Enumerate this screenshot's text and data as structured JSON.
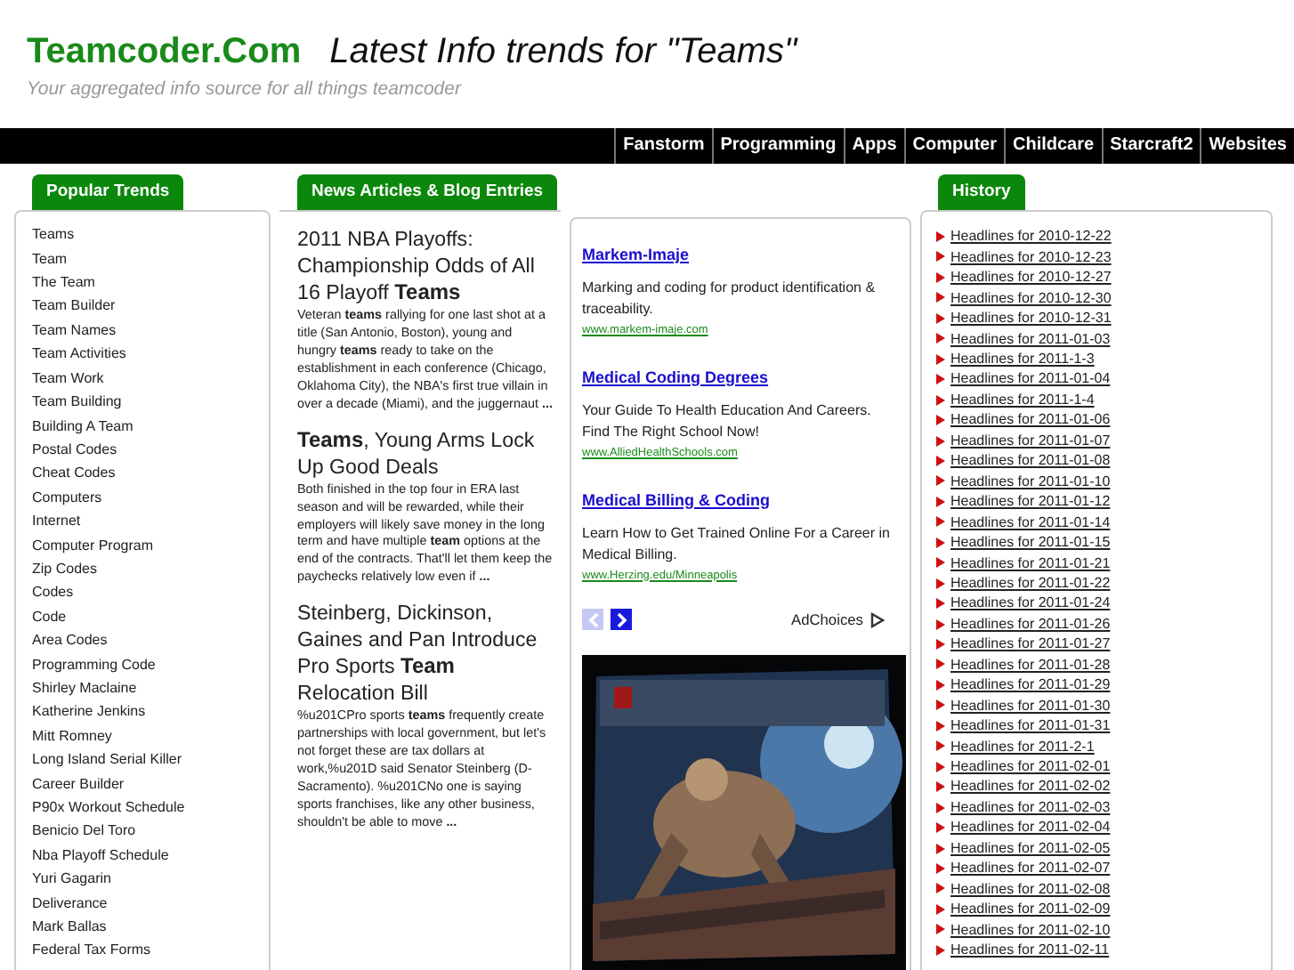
{
  "header": {
    "logo": "Teamcoder.Com",
    "headline": "Latest Info trends for \"Teams\"",
    "tagline": "Your aggregated info source for all things teamcoder"
  },
  "nav": [
    "Fanstorm",
    "Programming",
    "Apps",
    "Computer",
    "Childcare",
    "Starcraft2",
    "Websites"
  ],
  "trends": {
    "title": "Popular Trends",
    "items": [
      "Teams",
      "Team",
      "The Team",
      "Team Builder",
      "Team Names",
      "Team Activities",
      "Team Work",
      "Team Building",
      "Building A Team",
      "Postal Codes",
      "Cheat Codes",
      "Computers",
      "Internet",
      "Computer Program",
      "Zip Codes",
      "Codes",
      "Code",
      "Area Codes",
      "Programming Code",
      "Shirley Maclaine",
      "Katherine Jenkins",
      "Mitt Romney",
      "Long Island Serial Killer",
      "Career Builder",
      "P90x Workout Schedule",
      "Benicio Del Toro",
      "Nba Playoff Schedule",
      "Yuri Gagarin",
      "Deliverance",
      "Mark Ballas",
      "Federal Tax Forms"
    ]
  },
  "news": {
    "title": "News Articles & Blog Entries",
    "articles": [
      {
        "title": "2011 NBA Playoffs: Championship Odds of All 16 Playoff **Teams**",
        "summary": "Veteran **teams** rallying for one last shot at a title (San Antonio, Boston), young and hungry **teams** ready to take on the establishment in each conference (Chicago, Oklahoma City), the NBA's first true villain in over a decade (Miami), and the juggernaut **...**"
      },
      {
        "title": "**Teams**, Young Arms Lock Up Good Deals",
        "summary": "Both finished in the top four in ERA last season and will be rewarded, while their employers will likely save money in the long term and have multiple **team** options at the end of the contracts. That'll let them keep the paychecks relatively low even if **...**"
      },
      {
        "title": "Steinberg, Dickinson, Gaines and Pan Introduce Pro Sports **Team** Relocation Bill",
        "summary": "%u201CPro sports **teams** frequently create partnerships with local government, but let's not forget these are tax dollars at work,%u201D said Senator Steinberg (D-Sacramento). %u201CNo one is saying sports franchises, like any other business, shouldn't be able to move **...**"
      }
    ]
  },
  "ads": {
    "items": [
      {
        "title": "Markem-Imaje",
        "text": "Marking and coding for product identification & traceability.",
        "url": "www.markem-imaje.com"
      },
      {
        "title": "Medical Coding Degrees",
        "text": "Your Guide To Health Education And Careers. Find The Right School Now!",
        "url": "www.AlliedHealthSchools.com"
      },
      {
        "title": "Medical Billing & Coding",
        "text": "Learn How to Get Trained Online For a Career in Medical Billing.",
        "url": "www.Herzing.edu/Minneapolis"
      }
    ],
    "prev": {
      "disabled": true
    },
    "next": {
      "disabled": false
    },
    "adchoices": "AdChoices"
  },
  "history": {
    "title": "History",
    "items": [
      "Headlines for 2010-12-22",
      "Headlines for 2010-12-23",
      "Headlines for 2010-12-27",
      "Headlines for 2010-12-30",
      "Headlines for 2010-12-31",
      "Headlines for 2011-01-03",
      "Headlines for 2011-1-3",
      "Headlines for 2011-01-04",
      "Headlines for 2011-1-4",
      "Headlines for 2011-01-06",
      "Headlines for 2011-01-07",
      "Headlines for 2011-01-08",
      "Headlines for 2011-01-10",
      "Headlines for 2011-01-12",
      "Headlines for 2011-01-14",
      "Headlines for 2011-01-15",
      "Headlines for 2011-01-21",
      "Headlines for 2011-01-22",
      "Headlines for 2011-01-24",
      "Headlines for 2011-01-26",
      "Headlines for 2011-01-27",
      "Headlines for 2011-01-28",
      "Headlines for 2011-01-29",
      "Headlines for 2011-01-30",
      "Headlines for 2011-01-31",
      "Headlines for 2011-2-1",
      "Headlines for 2011-02-01",
      "Headlines for 2011-02-02",
      "Headlines for 2011-02-03",
      "Headlines for 2011-02-04",
      "Headlines for 2011-02-05",
      "Headlines for 2011-02-07",
      "Headlines for 2011-02-08",
      "Headlines for 2011-02-09",
      "Headlines for 2011-02-10",
      "Headlines for 2011-02-11"
    ]
  }
}
